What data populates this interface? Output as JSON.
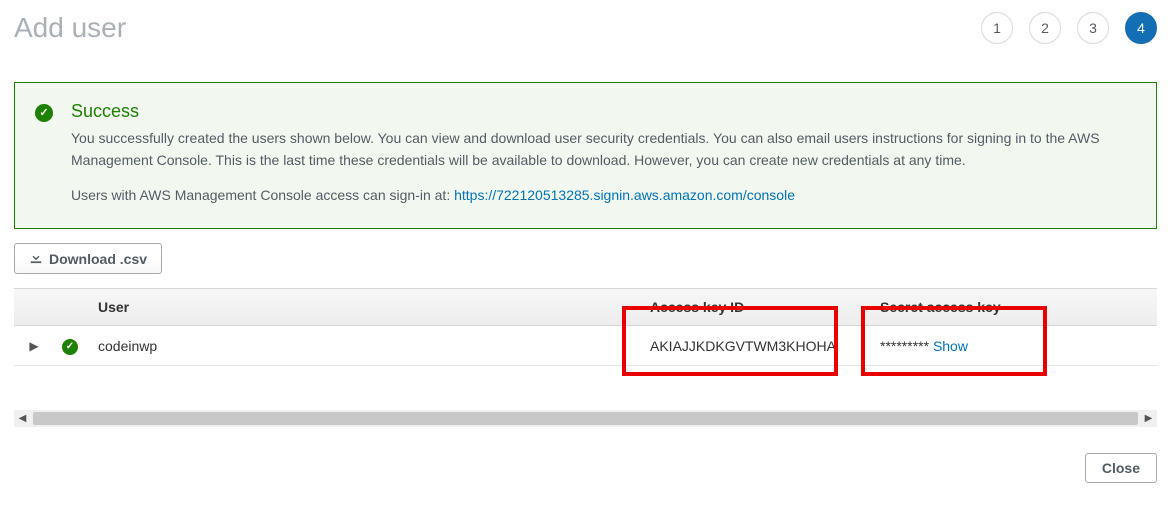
{
  "page": {
    "title": "Add user"
  },
  "wizard": {
    "steps": [
      "1",
      "2",
      "3",
      "4"
    ],
    "active_index": 3
  },
  "alert": {
    "title": "Success",
    "body": "You successfully created the users shown below. You can view and download user security credentials. You can also email users instructions for signing in to the AWS Management Console. This is the last time these credentials will be available to download. However, you can create new credentials at any time.",
    "signin_prefix": "Users with AWS Management Console access can sign-in at: ",
    "signin_link": "https://722120513285.signin.aws.amazon.com/console"
  },
  "buttons": {
    "download": "Download .csv",
    "close": "Close",
    "show": "Show"
  },
  "table": {
    "headers": {
      "user": "User",
      "access_key": "Access key ID",
      "secret_key": "Secret access key"
    },
    "rows": [
      {
        "user": "codeinwp",
        "access_key_id": "AKIAJJKDKGVTWM3KHOHA",
        "secret_masked": "*********"
      }
    ]
  }
}
